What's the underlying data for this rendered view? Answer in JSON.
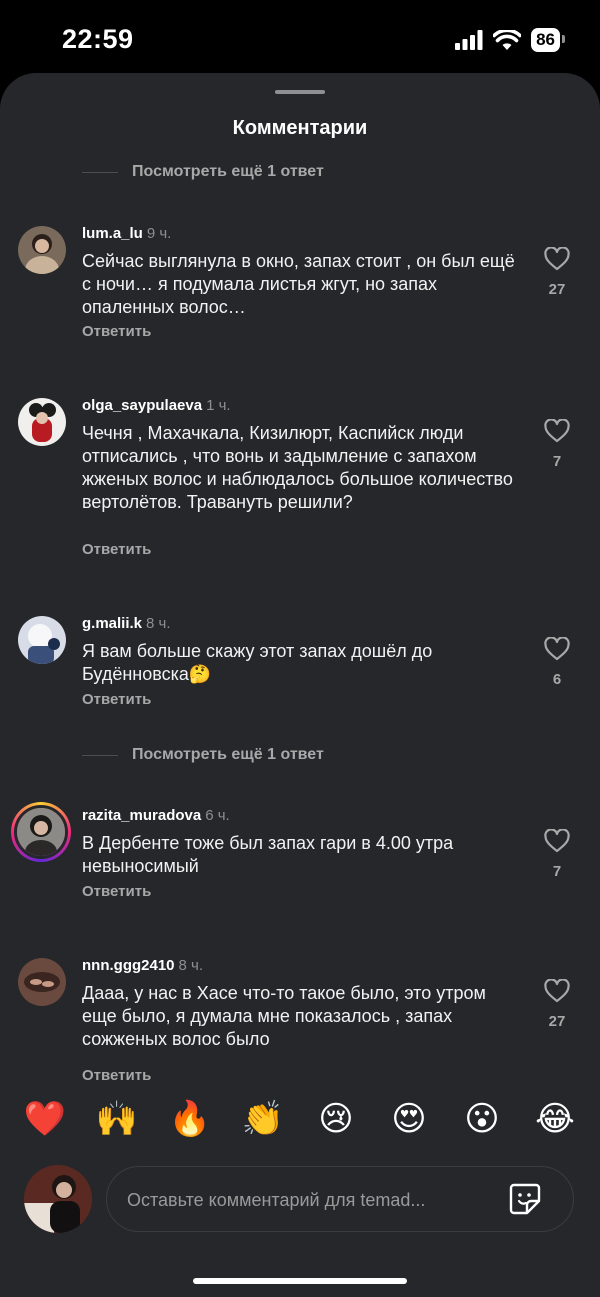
{
  "status": {
    "time": "22:59",
    "battery": "86"
  },
  "sheet": {
    "title": "Комментарии"
  },
  "more_replies_1": "Посмотреть ещё 1 ответ",
  "more_replies_2": "Посмотреть ещё 1 ответ",
  "comments": [
    {
      "user": "lum.a_lu",
      "time": "9 ч.",
      "text": "Сейчас выглянула в окно, запах стоит , он был ещё с ночи… я подумала листья жгут, но запах опаленных волос…",
      "reply": "Ответить",
      "likes": "27"
    },
    {
      "user": "olga_saypulaeva",
      "time": "1 ч.",
      "text": "Чечня , Махачкала, Кизилюрт, Каспийск люди отписались , что вонь и задымление с запахом жженых волос и наблюдалось большое количество вертолётов. Травануть решили?",
      "reply": "Ответить",
      "likes": "7"
    },
    {
      "user": "g.malii.k",
      "time": "8 ч.",
      "text": "Я вам больше скажу этот запах дошёл до Будённовска🤔",
      "reply": "Ответить",
      "likes": "6"
    },
    {
      "user": "razita_muradova",
      "time": "6 ч.",
      "text": "В Дербенте тоже был запах гари в 4.00 утра невыносимый",
      "reply": "Ответить",
      "likes": "7"
    },
    {
      "user": "nnn.ggg2410",
      "time": "8 ч.",
      "text": "Дааа, у нас в Хасе что-то такое было, это утром еще было, я думала мне показалось , запах сожженых волос было",
      "reply": "Ответить",
      "likes": "27"
    }
  ],
  "reactions": [
    "❤️",
    "🙌",
    "🔥",
    "👏",
    "😢",
    "😍",
    "😮",
    "😂"
  ],
  "composer": {
    "placeholder": "Оставьте комментарий для temad..."
  },
  "icons": {
    "like": "heart-outline-icon",
    "sticker": "sticker-icon"
  }
}
